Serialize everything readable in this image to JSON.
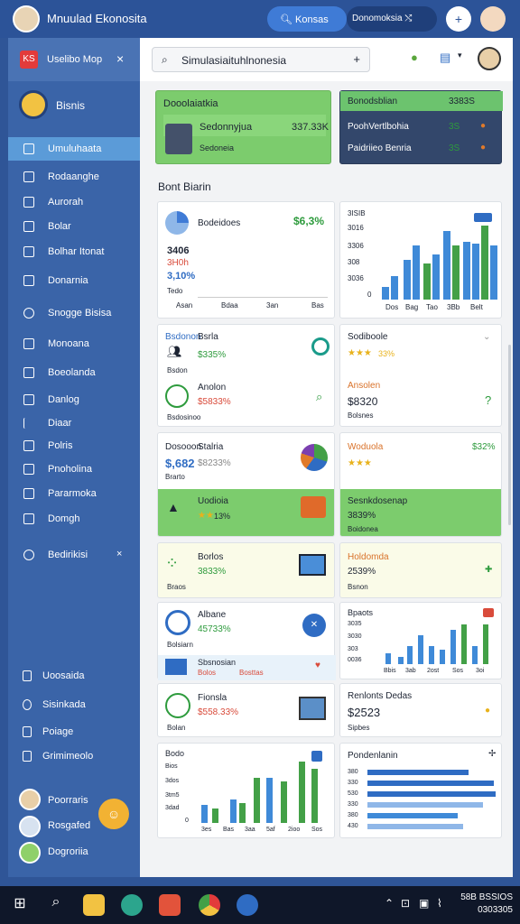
{
  "window": {
    "title": "Mnuulad Ekonosita",
    "search_label": "Konsas",
    "select_label": "Donomoksia",
    "select_icon": "⤭",
    "plus": "+"
  },
  "sidebar": {
    "logo": "KS",
    "title": "Uselibo Mop",
    "close": "×",
    "profile_name": "Bisnis",
    "nav": [
      "Umuluhaata",
      "Rodaanghe",
      "Aurorah",
      "Bolar",
      "Bolhar Itonat",
      "Donarnia",
      "Snogge Bisisa",
      "Monoana",
      "Boeolanda",
      "Danlog",
      "Diaar",
      "Polris",
      "Pnoholina",
      "Pararmoka",
      "Domgh"
    ],
    "section": "Bedirikisi",
    "section_close": "×",
    "footer": [
      "Uoosaida",
      "Sisinkada",
      "Poiage",
      "Grimimeolo"
    ],
    "users": [
      "Poorraris",
      "Rosgafed",
      "Dogroriia"
    ],
    "fab": "☺"
  },
  "header": {
    "search": "Simulasiaituhlnonesia",
    "plus": "+"
  },
  "top_cards": {
    "green": {
      "title": "Dooolaiatkia",
      "name": "Sedonnyjua",
      "value": "337.33K",
      "sub": "Sedoneia"
    },
    "dark": {
      "title": "Bonodsblian",
      "value": "3383S",
      "rows": [
        {
          "label": "PoohVertlbohia",
          "value": "3S"
        },
        {
          "label": "Paidriieo Benria",
          "value": "3S"
        }
      ]
    }
  },
  "section_title": "Bont Biarin",
  "cards": {
    "c1": {
      "title": "Bodeidoes",
      "pct": "$6,3%",
      "v1": "3406",
      "v2": "3H0h",
      "v3": "3,10%",
      "v4": "Tedo",
      "ticks": [
        "Asan",
        "Bdaa",
        "3an",
        "Bas"
      ]
    },
    "c2": {
      "ticks_y": [
        "3ISIB",
        "3016",
        "3306",
        "308",
        "3036",
        "0"
      ],
      "ticks_x": [
        "Dos",
        "Bag",
        "Tao",
        "3Bb",
        "Belt"
      ]
    },
    "c3": {
      "title": "Bsdonon",
      "name": "Bsrla",
      "value": "$335%",
      "sub": "Bsdon",
      "name2": "Anolon",
      "value2": "$5833%",
      "sub2": "Bsdosinoo"
    },
    "c4": {
      "title": "Sodiboole",
      "stars_pct": "33%",
      "name": "Ansolen",
      "value": "$8320",
      "sub": "Bolsnes",
      "icon": "?"
    },
    "c5": {
      "title": "Dosooon",
      "name": "Stalria",
      "value": "$,682",
      "pct": "$8233%",
      "sub": "Brarto"
    },
    "c6": {
      "title": "Woduola",
      "pct": "$32%",
      "stars": "★★★"
    },
    "c7": {
      "title": "Uodioia",
      "stars_pct": "13%"
    },
    "c8": {
      "title": "Sesnkdosenap",
      "value": "3839%",
      "sub": "Boidonea"
    },
    "c9": {
      "title": "Borlos",
      "value": "3833%",
      "sub": "Braos"
    },
    "c10": {
      "title": "Holdomda",
      "value": "2539%",
      "sub": "Bsnon"
    },
    "c11": {
      "title": "Albane",
      "value": "45733%",
      "sub": "Bolsiarn",
      "strip": "Sbsnosian",
      "strip_sub": "Bolos",
      "strip_sub2": "Bosttas"
    },
    "c12": {
      "title": "Bpaots",
      "ticks_y": [
        "3035",
        "3030",
        "303",
        "0036"
      ],
      "ticks_x": [
        "Bbis",
        "3ab",
        "2ost",
        "Sos",
        "3oi"
      ]
    },
    "c13": {
      "title": "Fionsla",
      "value": "$558.33%",
      "sub": "Bolan"
    },
    "c14": {
      "title": "Renlonts Dedas",
      "value": "$2523",
      "sub": "Sipbes"
    },
    "c15": {
      "title": "Bodo",
      "ticks_y": [
        "Bios",
        "3dos",
        "3tm5",
        "3dad",
        "0"
      ],
      "ticks_x": [
        "3es",
        "Bas",
        "3aa",
        "5af",
        "2ioo",
        "Sos"
      ]
    },
    "c16": {
      "title": "Pondenlanin",
      "rows": [
        "380",
        "330",
        "530",
        "330",
        "380",
        "430"
      ]
    }
  },
  "taskbar": {
    "time": "58B BSSIOS",
    "date": "0303305"
  },
  "colors": {
    "accent": "#3f7bd6",
    "green": "#6cc36e",
    "sidebar": "#3a64a8"
  }
}
